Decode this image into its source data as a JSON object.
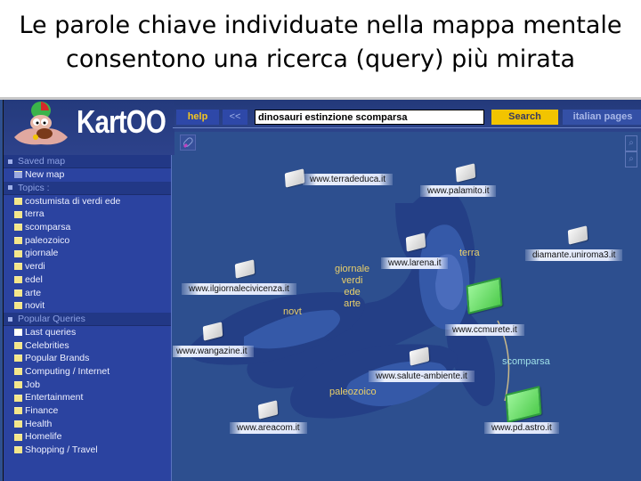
{
  "slide": {
    "title_line1": "Le parole chiave individuate nella mappa mentale",
    "title_line2": "consentono una ricerca (query) più mirata"
  },
  "app": {
    "logo": "KartOO",
    "help_label": "help",
    "back_label": "<<",
    "search_value": "dinosauri estinzione scomparsa",
    "search_label": "Search",
    "language_label": "italian pages",
    "colors": {
      "search_button": "#f2c400",
      "map_bg": "#2d4f8f",
      "keyword": "#e9cf6a",
      "active_doc": "#4ecb4c"
    }
  },
  "sidebar": {
    "saved_map": {
      "label": "Saved map",
      "items": [
        "New map"
      ]
    },
    "topics": {
      "label": "Topics :",
      "items": [
        "costumista di verdi ede",
        "terra",
        "scomparsa",
        "paleozoico",
        "giornale",
        "verdi",
        "edel",
        "arte",
        "novit"
      ]
    },
    "popular": {
      "label": "Popular Queries",
      "items": [
        "Last queries",
        "Celebrities",
        "Popular Brands",
        "Computing / Internet",
        "Job",
        "Entertainment",
        "Finance",
        "Health",
        "Homelife",
        "Shopping / Travel"
      ]
    }
  },
  "map": {
    "icons": {
      "eraser": "eraser-icon",
      "zoom_in": "zoom-in-icon",
      "zoom_out": "zoom-out-icon"
    },
    "sites": [
      "www.terradeduca.it",
      "www.palamito.it",
      "www.larena.it",
      "diamante.uniroma3.it",
      "www.ilgiornalecivicenza.it",
      "www.ccmurete.it",
      "www.wangazine.it",
      "www.salute-ambiente.it",
      "www.areacom.it",
      "www.pd.astro.it"
    ],
    "keywords": {
      "cluster": "giornale\nverdi\nede\narte",
      "terra": "terra",
      "novit": "novt",
      "paleozoico": "paleozoico",
      "scomparsa": "scomparsa"
    }
  }
}
